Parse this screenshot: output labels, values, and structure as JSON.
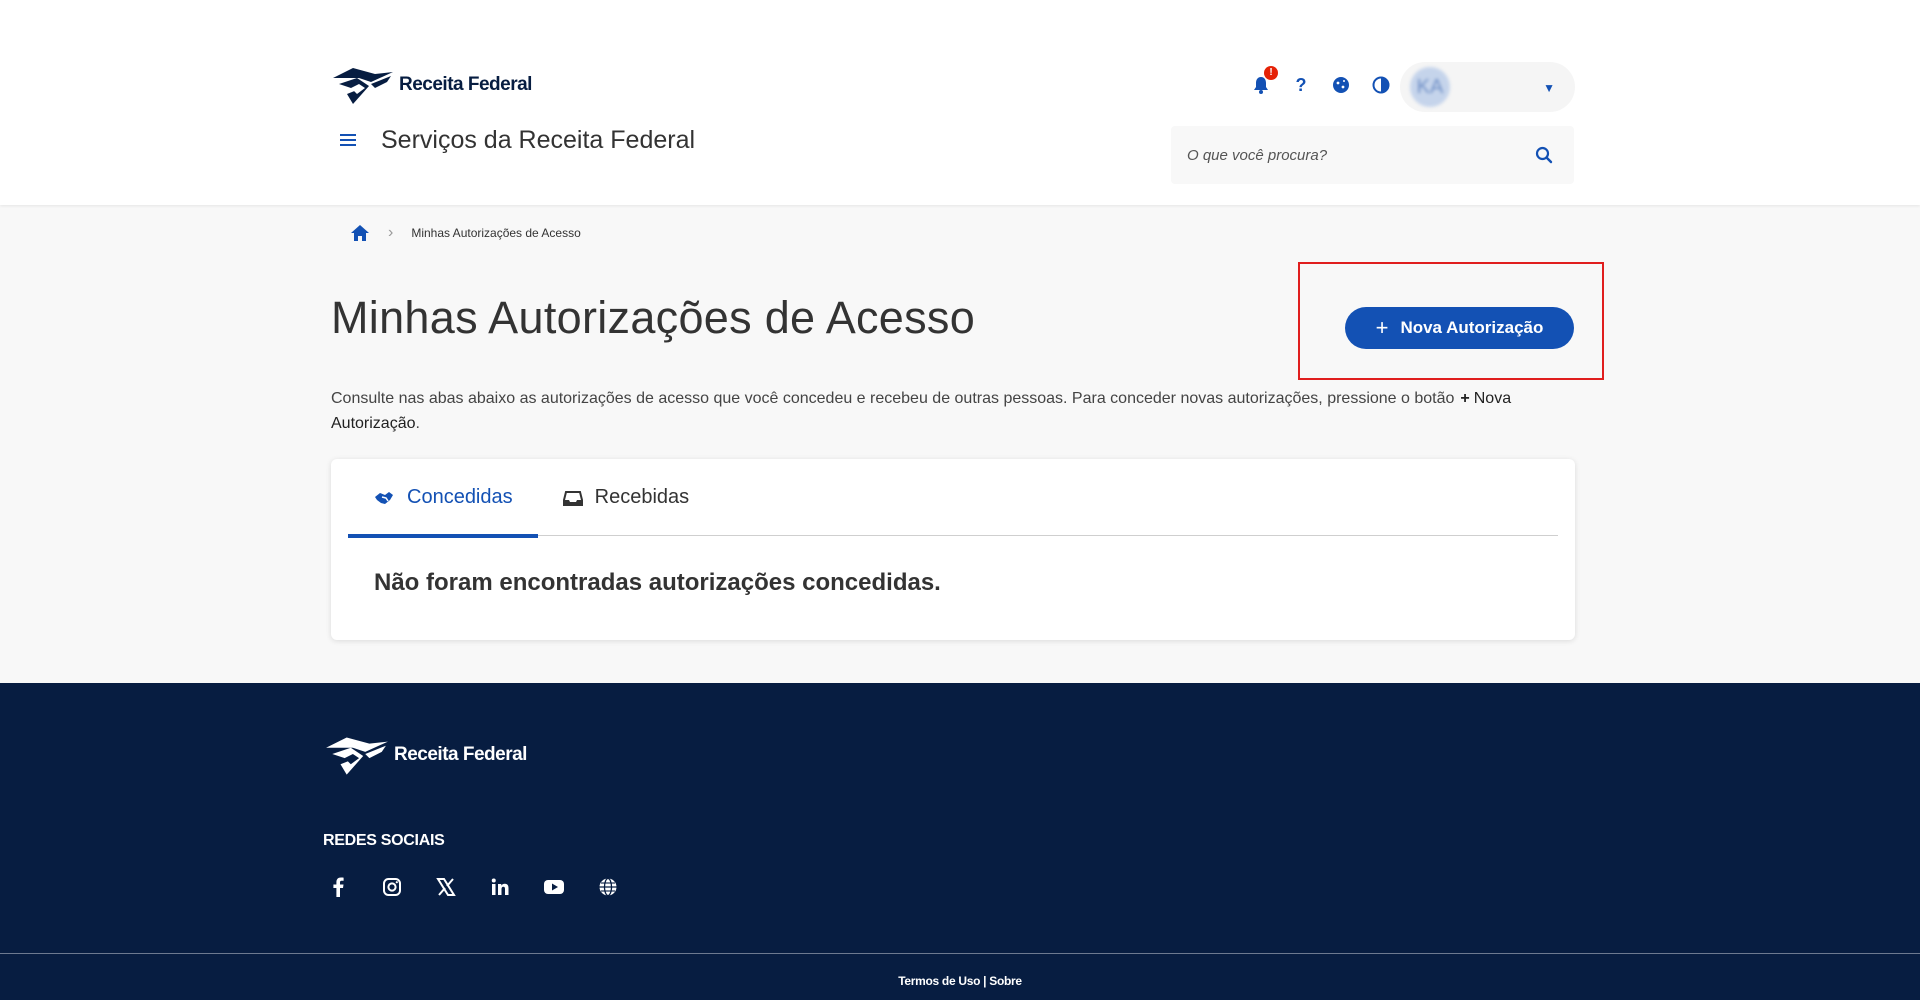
{
  "header": {
    "logo_text": "Receita Federal",
    "site_title": "Serviços da Receita Federal",
    "notification_badge": "!",
    "user_initials": "KA",
    "search_placeholder": "O que você procura?"
  },
  "breadcrumb": {
    "current": "Minhas Autorizações de Acesso"
  },
  "page": {
    "title": "Minhas Autorizações de Acesso",
    "new_button_icon": "+",
    "new_button_label": "Nova Autorização",
    "description_text": "Consulte nas abas abaixo as autorizações de acesso que você concedeu e recebeu de outras pessoas. Para conceder novas autorizações, pressione o botão",
    "description_plus": "+",
    "description_button_ref": "Nova Autorização",
    "description_end": "."
  },
  "tabs": [
    {
      "label": "Concedidas",
      "icon": "handshake-icon",
      "active": true
    },
    {
      "label": "Recebidas",
      "icon": "inbox-icon",
      "active": false
    }
  ],
  "empty_message": "Não foram encontradas autorizações concedidas.",
  "footer": {
    "logo_text": "Receita Federal",
    "social_title": "REDES SOCIAIS",
    "social_icons": [
      "facebook-icon",
      "instagram-icon",
      "x-icon",
      "linkedin-icon",
      "youtube-icon",
      "globe-icon"
    ],
    "link_terms": "Termos de Uso",
    "link_separator": " | ",
    "link_about": "Sobre"
  },
  "colors": {
    "primary": "#1351b4",
    "footer_bg": "#071d41",
    "highlight": "#e01e1e"
  }
}
